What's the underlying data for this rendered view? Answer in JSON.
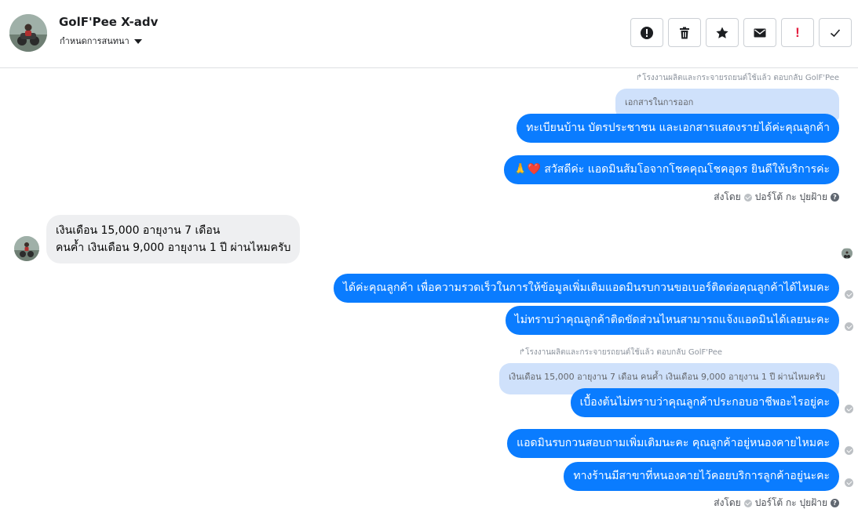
{
  "header": {
    "contact_name": "GolF'Pee X-adv",
    "subtitle": "กำหนดการสนทนา"
  },
  "toolbar": {
    "buttons": [
      "report-icon",
      "trash-icon",
      "star-icon",
      "envelope-icon",
      "exclamation-icon",
      "check-icon"
    ],
    "exclamation_label": "!"
  },
  "messages": {
    "reply1_meta": "↱โรงงานผลิตและกระจายรถยนต์ใช้แล้ว ตอบกลับ GolF'Pee",
    "quote1": "เอกสารในการออก",
    "msg1": "ทะเบียนบ้าน บัตรประชาชน และเอกสารแสดงรายได้ค่ะคุณลูกค้า",
    "msg2_emoji": "🙏❤️",
    "msg2": " สวัสดีค่ะ แอดมินส้มโอจากโชคคุณโชคอุดร ยินดีให้บริการค่ะ",
    "sent_by_label": "ส่งโดย",
    "sent_by_name": "ปอร์โต้ กะ ปุยฝ้าย",
    "incoming_line1": "เงินเดือน 15,000 อายุงาน 7 เดือน",
    "incoming_line2": "คนค้ำ เงินเดือน 9,000 อายุงาน 1 ปี ผ่านไหมครับ",
    "msg3": "ได้ค่ะคุณลูกค้า  เพื่อความรวดเร็วในการให้ข้อมูลเพิ่มเติมแอดมินรบกวนขอเบอร์ติดต่อคุณลูกค้าได้ไหมคะ",
    "msg4": "ไม่ทราบว่าคุณลูกค้าติดขัดส่วนไหนสามารถแจ้งแอดมินได้เลยนะคะ",
    "reply2_meta": "↱โรงงานผลิตและกระจายรถยนต์ใช้แล้ว ตอบกลับ GolF'Pee",
    "quote2": "เงินเดือน 15,000 อายุงาน 7 เดือน คนค้ำ เงินเดือน 9,000 อายุงาน 1 ปี ผ่านไหมครับ",
    "msg5": "เบื้องต้นไม่ทราบว่าคุณลูกค้าประกอบอาชีพอะไรอยู่คะ",
    "msg6": "แอดมินรบกวนสอบถามเพิ่มเติมนะคะ คุณลูกค้าอยู่หนองคายไหมคะ",
    "msg7": "ทางร้านมีสาขาที่หนองคายไว้คอยบริการลูกค้าอยู่นะคะ"
  },
  "colors": {
    "outgoing": "#0a7cff",
    "quote": "#cfe1fb",
    "incoming": "#eeeff1"
  }
}
